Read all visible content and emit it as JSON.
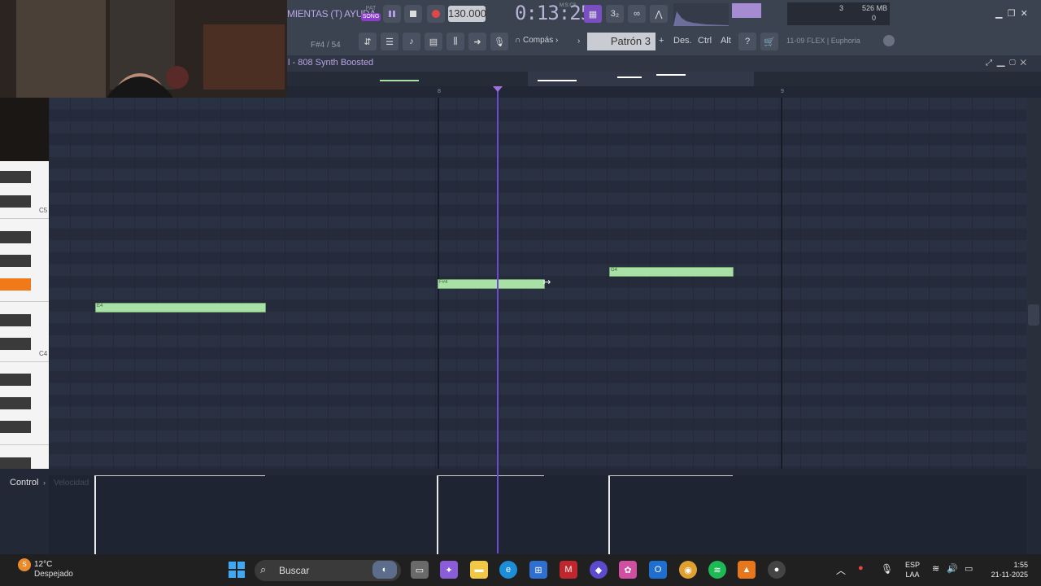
{
  "toolbar": {
    "menu_text": "MIENTAS (T) AYUDA",
    "pat_label": "PAT",
    "song_label": "SONG",
    "tempo": "130.000",
    "time": "0:13:25",
    "time_unit": "M:S:CS",
    "cpu_value": "3",
    "memory": "526 MB",
    "voices": "0",
    "colors": {
      "accent": "#8a3fc8",
      "bg": "#3b4250"
    }
  },
  "second_row": {
    "note_info": "F#4 / 54",
    "snap_label": "Compás",
    "pattern_label": "Patrón 3",
    "pattern_add": "+",
    "key_des": "Des.",
    "key_ctrl": "Ctrl",
    "key_alt": "Alt",
    "hint": "11-09  FLEX | Euphoria"
  },
  "piano_roll": {
    "title": "l - 808 Synth Boosted",
    "timeline_marks": [
      "8",
      "9"
    ],
    "key_labels": [
      "C5",
      "C4"
    ],
    "notes": [
      {
        "label": "E4"
      },
      {
        "label": "F#4"
      },
      {
        "label": "G4"
      }
    ],
    "colors": {
      "note": "#a9e0a6",
      "highlight_key": "#f07a1a",
      "playhead": "#6d4bd0"
    }
  },
  "control": {
    "label": "Control",
    "sub_label": "Velocidad"
  },
  "taskbar": {
    "weather_temp": "12°C",
    "weather_desc": "Despejado",
    "search_placeholder": "Buscar",
    "lang_top": "ESP",
    "lang_bottom": "LAA",
    "time": "1:55",
    "date": "21-11-2025"
  }
}
